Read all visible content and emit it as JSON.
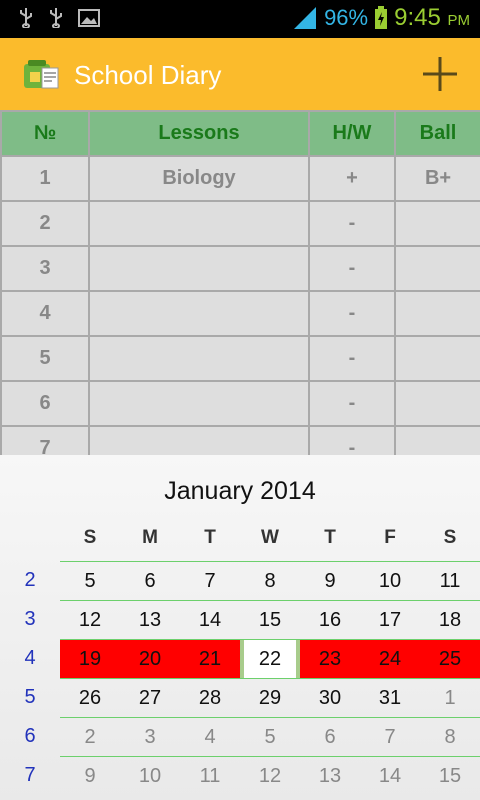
{
  "status_bar": {
    "battery_percent": "96%",
    "time": "9:45",
    "ampm": "PM",
    "icons": [
      "usb-icon",
      "usb-icon",
      "image-icon",
      "signal-icon",
      "battery-charging-icon"
    ]
  },
  "app_bar": {
    "title": "School Diary",
    "add_icon": "plus-icon"
  },
  "lessons_table": {
    "headers": [
      "№",
      "Lessons",
      "H/W",
      "Ball"
    ],
    "rows": [
      {
        "num": "1",
        "lesson": "Biology",
        "hw": "+",
        "ball": "B+"
      },
      {
        "num": "2",
        "lesson": "",
        "hw": "-",
        "ball": ""
      },
      {
        "num": "3",
        "lesson": "",
        "hw": "-",
        "ball": ""
      },
      {
        "num": "4",
        "lesson": "",
        "hw": "-",
        "ball": ""
      },
      {
        "num": "5",
        "lesson": "",
        "hw": "-",
        "ball": ""
      },
      {
        "num": "6",
        "lesson": "",
        "hw": "-",
        "ball": ""
      },
      {
        "num": "7",
        "lesson": "",
        "hw": "-",
        "ball": ""
      }
    ]
  },
  "calendar": {
    "month_title": "January 2014",
    "weekdays": [
      "S",
      "M",
      "T",
      "W",
      "T",
      "F",
      "S"
    ],
    "weeks": [
      {
        "week_num": "2",
        "days": [
          "5",
          "6",
          "7",
          "8",
          "9",
          "10",
          "11"
        ]
      },
      {
        "week_num": "3",
        "days": [
          "12",
          "13",
          "14",
          "15",
          "16",
          "17",
          "18"
        ]
      },
      {
        "week_num": "4",
        "days": [
          "19",
          "20",
          "21",
          "22",
          "23",
          "24",
          "25"
        ]
      },
      {
        "week_num": "5",
        "days": [
          "26",
          "27",
          "28",
          "29",
          "30",
          "31",
          "1"
        ]
      },
      {
        "week_num": "6",
        "days": [
          "2",
          "3",
          "4",
          "5",
          "6",
          "7",
          "8"
        ]
      },
      {
        "week_num": "7",
        "days": [
          "9",
          "10",
          "11",
          "12",
          "13",
          "14",
          "15"
        ]
      }
    ],
    "selected_day": "22",
    "colors": {
      "focused_week": "#ff0000",
      "week_number": "#2233bb",
      "grid_line": "#6cd06c"
    }
  }
}
